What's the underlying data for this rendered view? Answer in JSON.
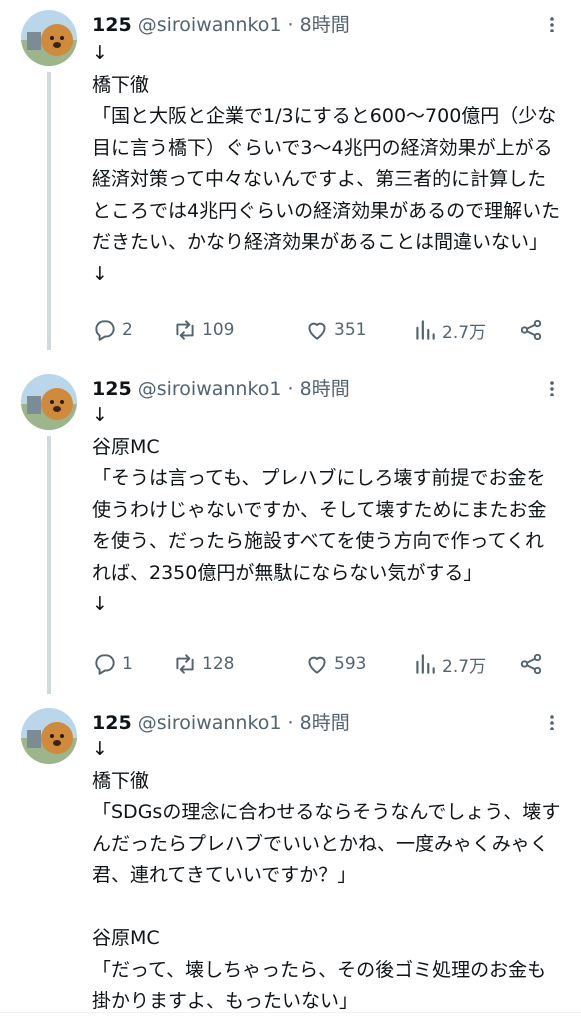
{
  "tweets": [
    {
      "name": "125",
      "handle": "@siroiwannko1",
      "time": "· 8時間",
      "text": "↓\n橋下徹\n「国と大阪と企業で1/3にすると600〜700億円（少な目に言う橋下）ぐらいで3〜4兆円の経済効果が上がる経済対策って中々ないんですよ、第三者的に計算したところでは4兆円ぐらいの経済効果があるので理解いただきたい、かなり経済効果があることは間違いない」\n↓",
      "replies": "2",
      "retweets": "109",
      "likes": "351",
      "views": "2.7万"
    },
    {
      "name": "125",
      "handle": "@siroiwannko1",
      "time": "· 8時間",
      "text": "↓\n谷原MC\n「そうは言っても、プレハブにしろ壊す前提でお金を使うわけじゃないですか、そして壊すためにまたお金を使う、だったら施設すべてを使う方向で作ってくれれば、2350億円が無駄にならない気がする」\n↓",
      "replies": "1",
      "retweets": "128",
      "likes": "593",
      "views": "2.7万"
    },
    {
      "name": "125",
      "handle": "@siroiwannko1",
      "time": "· 8時間",
      "text": "↓\n橋下徹\n「SDGsの理念に合わせるならそうなんでしょう、壊すんだったらプレハブでいいとかね、一度みゃくみゃく君、連れてきていいですか？」\n\n谷原MC\n「だって、壊しちゃったら、その後ゴミ処理のお金も掛かりますよ、もったいない」"
    }
  ],
  "colors": {
    "text": "#0f1419",
    "secondary": "#536471",
    "thread": "#cfd9de"
  },
  "icons": [
    "reply-icon",
    "retweet-icon",
    "like-icon",
    "views-icon",
    "share-icon",
    "more-icon"
  ]
}
